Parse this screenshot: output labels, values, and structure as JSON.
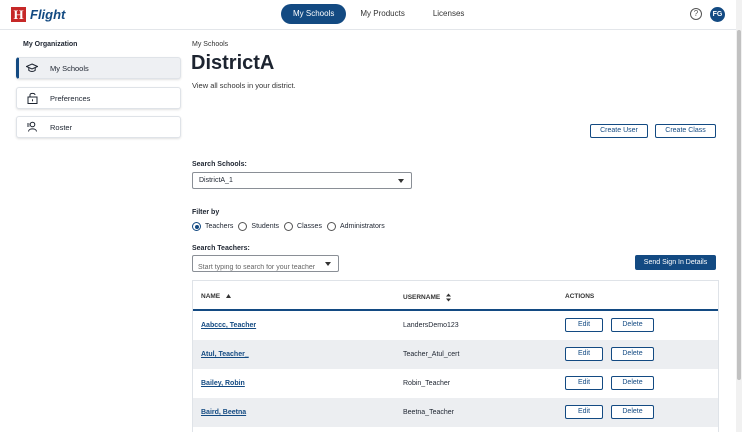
{
  "brand": {
    "logo_letter": "H",
    "name": "Flight"
  },
  "nav": {
    "tabs": [
      "My Schools",
      "My Products",
      "Licenses"
    ],
    "active": 0
  },
  "header": {
    "help_label": "?",
    "user_initials": "FG"
  },
  "sidebar": {
    "title": "My Organization",
    "items": [
      {
        "label": "My Schools",
        "icon": "graduation-cap-icon",
        "active": true
      },
      {
        "label": "Preferences",
        "icon": "lock-icon",
        "active": false
      },
      {
        "label": "Roster",
        "icon": "roster-icon",
        "active": false
      }
    ]
  },
  "main": {
    "breadcrumb": "My Schools",
    "title": "DistrictA",
    "subtitle": "View all schools in your district.",
    "create_user_label": "Create User",
    "create_class_label": "Create Class",
    "search_schools_label": "Search Schools:",
    "selected_school": "DistrictA_1",
    "filter_label": "Filter by",
    "filters": [
      "Teachers",
      "Students",
      "Classes",
      "Administrators"
    ],
    "selected_filter": "Teachers",
    "search_teachers_label": "Search Teachers:",
    "search_teachers_placeholder": "Start typing to search for your teacher",
    "send_signin_label": "Send Sign In Details"
  },
  "table": {
    "headers": {
      "name": "NAME",
      "username": "USERNAME",
      "actions": "ACTIONS"
    },
    "edit_label": "Edit",
    "delete_label": "Delete",
    "rows": [
      {
        "name": "Aabccc, Teacher",
        "username": "LandersDemo123"
      },
      {
        "name": "Atul, Teacher_",
        "username": "Teacher_Atul_cert"
      },
      {
        "name": "Bailey, Robin",
        "username": "Robin_Teacher"
      },
      {
        "name": "Baird, Beetna",
        "username": "Beetna_Teacher"
      }
    ]
  }
}
